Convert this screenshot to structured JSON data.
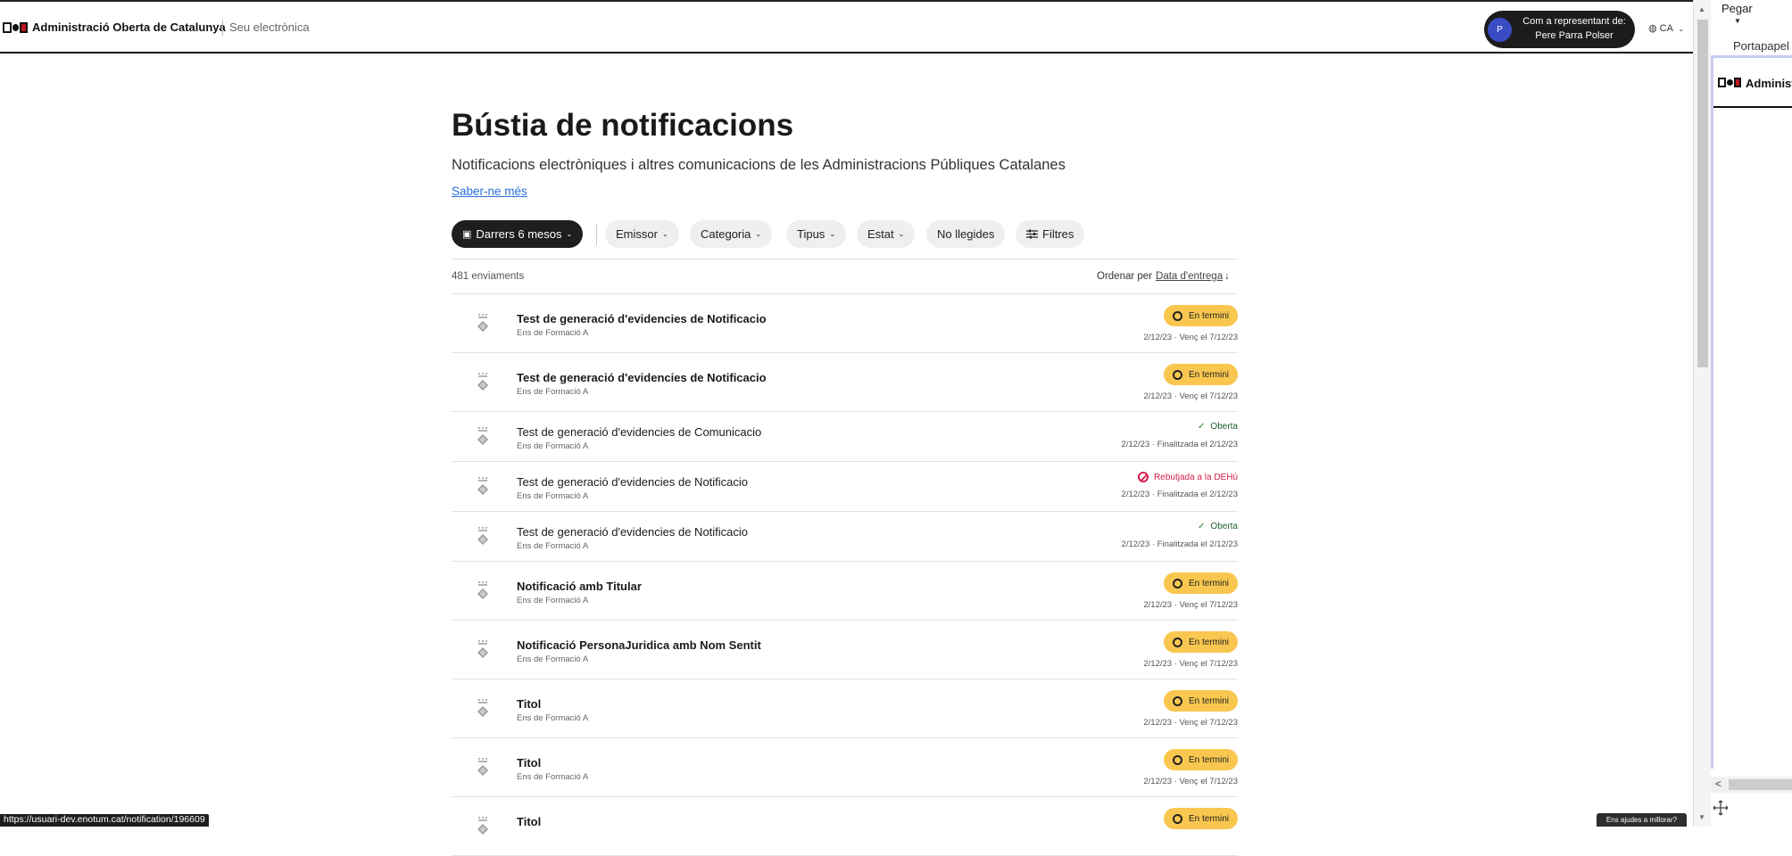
{
  "header": {
    "org_name": "Administració Oberta de Catalunya",
    "seu": "Seu electrònica",
    "representative_line1": "Com a representant de:",
    "representative_line2": "Pere Parra Polser",
    "avatar_initial": "P",
    "language": "CA"
  },
  "side_panel": {
    "paste_label": "Pegar",
    "clipboard_label": "Portapapel",
    "preview_org": "Administ"
  },
  "page": {
    "title": "Bústia de notificacions",
    "subtitle": "Notificacions electròniques i altres comunicacions de les Administracions Públiques Catalanes",
    "learn_more": "Saber-ne més"
  },
  "filters": {
    "period": "Darrers 6 mesos",
    "emissor": "Emissor",
    "categoria": "Categoria",
    "tipus": "Tipus",
    "estat": "Estat",
    "unread": "No llegides",
    "more_filters": "Filtres"
  },
  "list": {
    "count": "481 enviaments",
    "sort_label": "Ordenar per",
    "sort_field": "Data d'entrega",
    "items": [
      {
        "title": "Test de generació d'evidencies de Notificacio",
        "sender": "Ens de Formació A",
        "status": "En termini",
        "date": "2/12/23 · Venç el 7/12/23"
      },
      {
        "title": "Test de generació d'evidencies de Notificacio",
        "sender": "Ens de Formació A",
        "status": "En termini",
        "date": "2/12/23 · Venç el 7/12/23"
      },
      {
        "title": "Test de generació d'evidencies de Comunicacio",
        "sender": "Ens de Formació A",
        "status": "Oberta",
        "date": "2/12/23 · Finalitzada el 2/12/23"
      },
      {
        "title": "Test de generació d'evidencies de Notificacio",
        "sender": "Ens de Formació A",
        "status": "Rebutjada a la DEHú",
        "date": "2/12/23 · Finalitzada el 2/12/23"
      },
      {
        "title": "Test de generació d'evidencies de Notificacio",
        "sender": "Ens de Formació A",
        "status": "Oberta",
        "date": "2/12/23 · Finalitzada el 2/12/23"
      },
      {
        "title": "Notificació amb Titular",
        "sender": "Ens de Formació A",
        "status": "En termini",
        "date": "2/12/23 · Venç el 7/12/23"
      },
      {
        "title": "Notificació PersonaJuridica amb Nom Sentit",
        "sender": "Ens de Formació A",
        "status": "En termini",
        "date": "2/12/23 · Venç el 7/12/23"
      },
      {
        "title": "Titol",
        "sender": "Ens de Formació A",
        "status": "En termini",
        "date": "2/12/23 · Venç el 7/12/23"
      },
      {
        "title": "Titol",
        "sender": "Ens de Formació A",
        "status": "En termini",
        "date": "2/12/23 · Venç el 7/12/23"
      },
      {
        "title": "Titol",
        "status": "En termini"
      }
    ]
  },
  "statusbar": {
    "url": "https://usuari-dev.enotum.cat/notification/196609",
    "help": "Ens ajudes a millorar?"
  },
  "colors": {
    "accent_dark": "#1e1e1e",
    "badge_term": "#f9c74f",
    "status_open": "#2e7d32",
    "status_rejected": "#d6214d",
    "link": "#2a6fd6"
  }
}
